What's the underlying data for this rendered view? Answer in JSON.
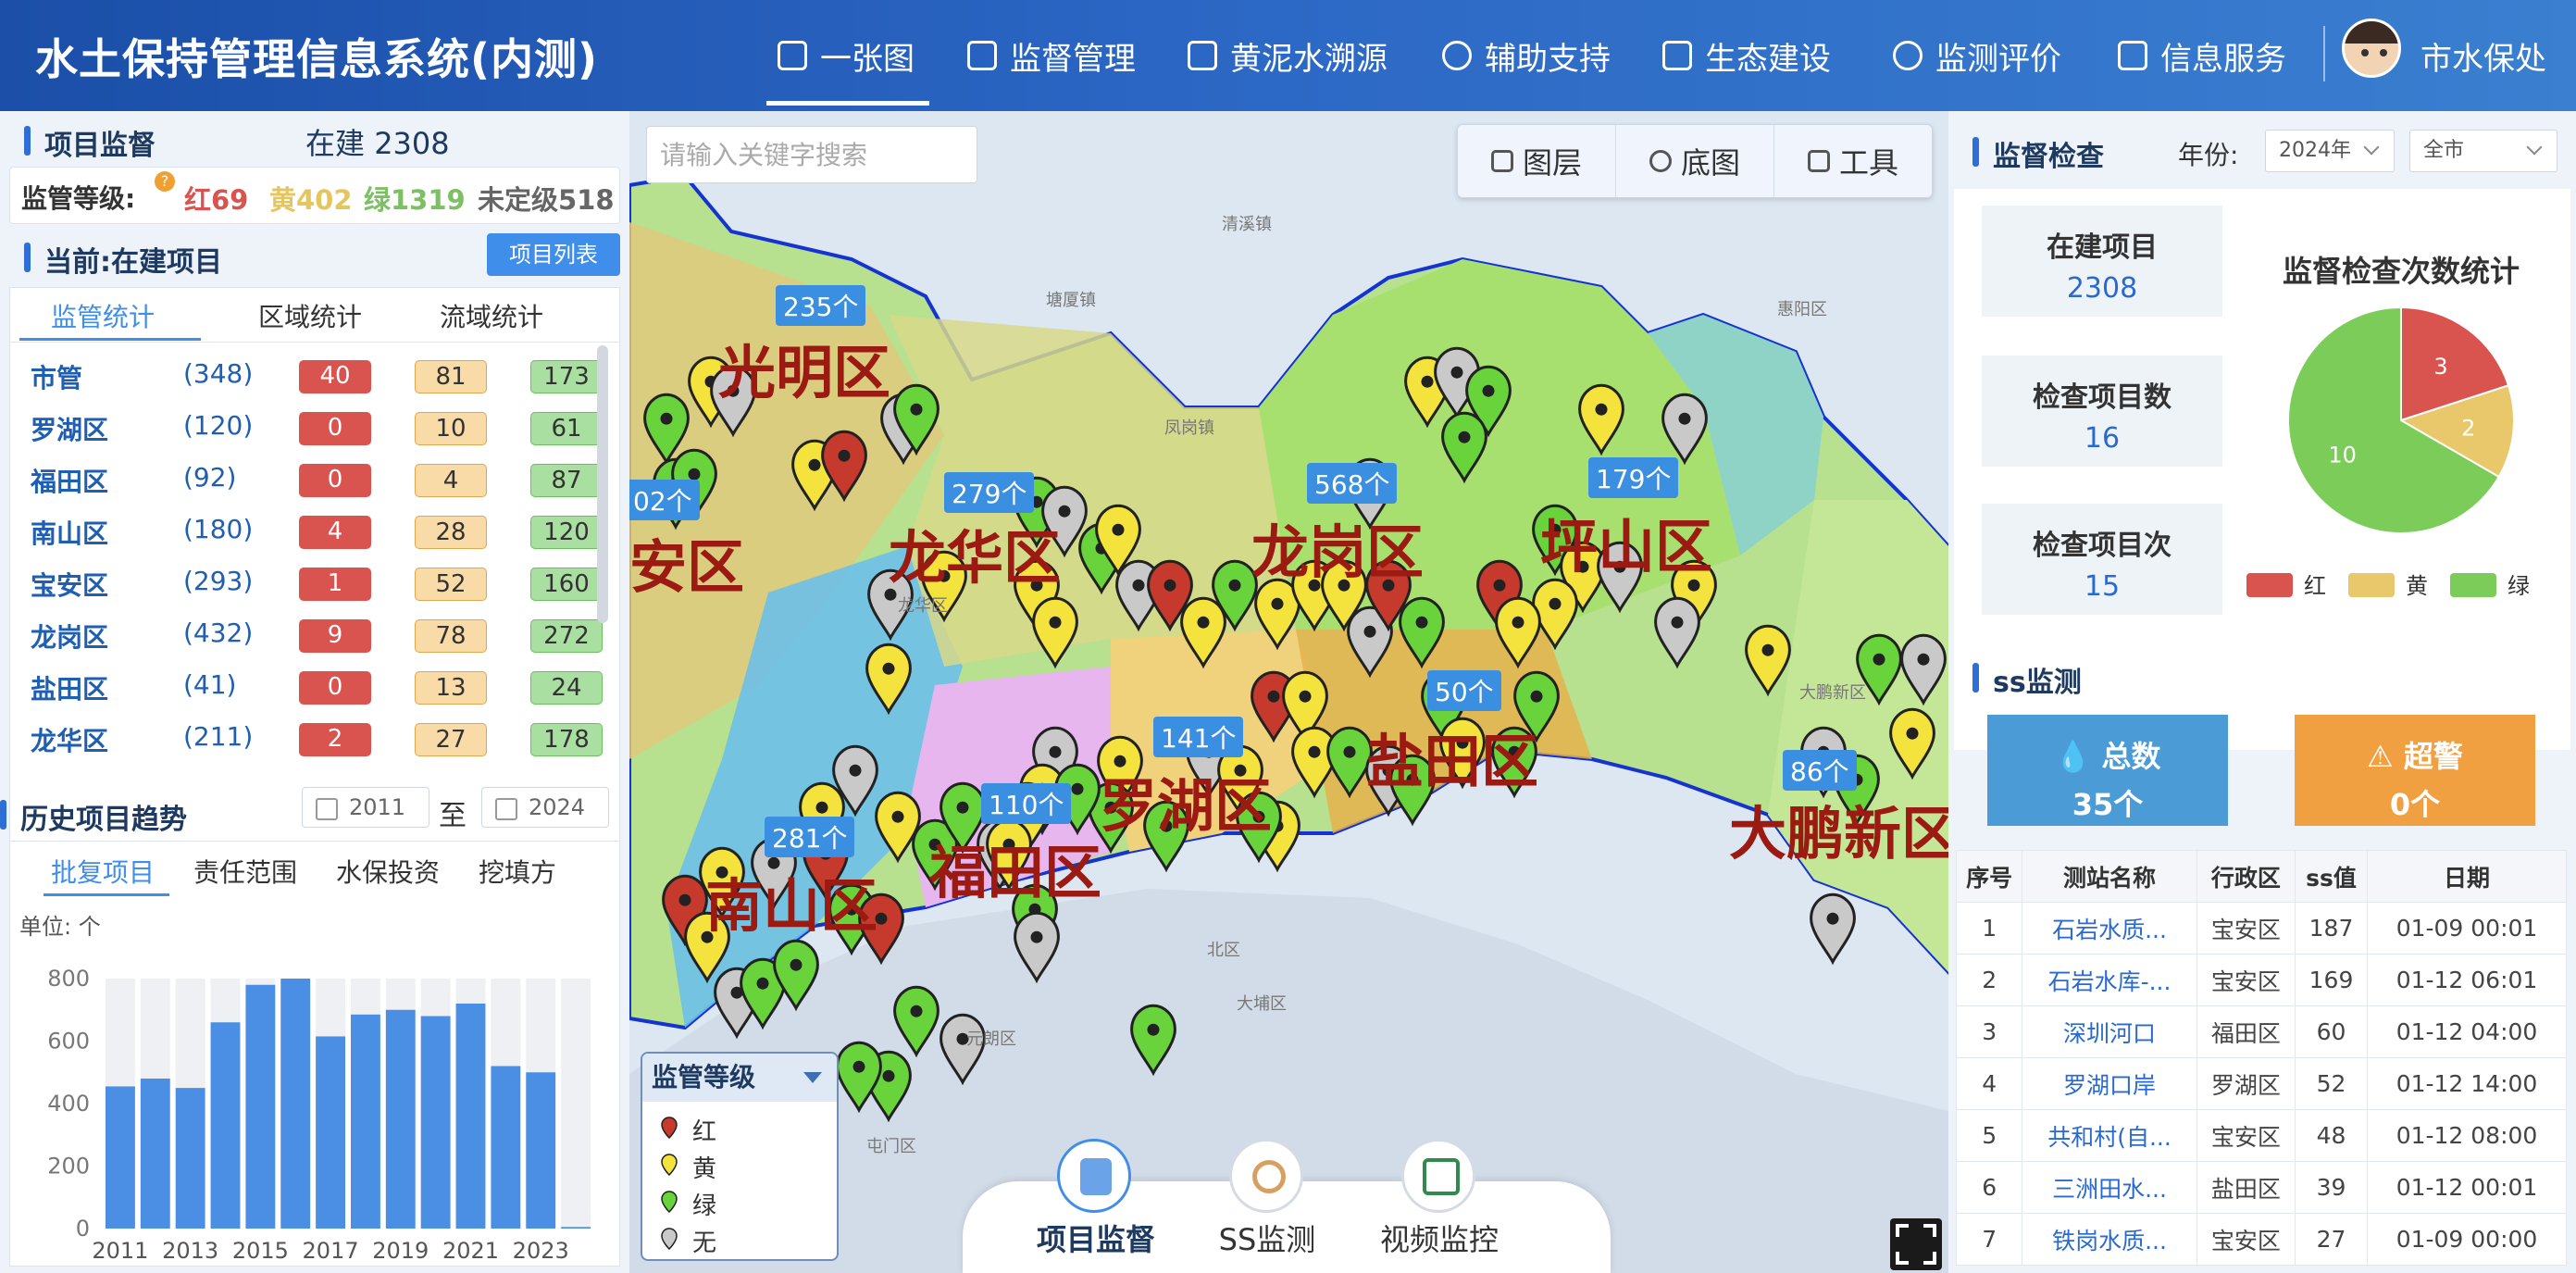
{
  "header": {
    "title": "水土保持管理信息系统(内测)",
    "nav": [
      "一张图",
      "监督管理",
      "黄泥水溯源",
      "辅助支持",
      "生态建设",
      "监测评价",
      "信息服务"
    ],
    "user": "市水保处"
  },
  "project": {
    "title": "项目监督",
    "building_label": "在建",
    "building_count": "2308",
    "level_label": "监管等级:",
    "levels": {
      "red": "红69",
      "yellow": "黄402",
      "green": "绿1319",
      "none": "未定级518"
    },
    "current_label": "当前:在建项目",
    "list_button": "项目列表",
    "tabs": [
      "监管统计",
      "区域统计",
      "流域统计"
    ],
    "rows": [
      {
        "name": "市管",
        "count": "(348)",
        "red": "40",
        "yellow": "81",
        "green": "173"
      },
      {
        "name": "罗湖区",
        "count": "(120)",
        "red": "0",
        "yellow": "10",
        "green": "61"
      },
      {
        "name": "福田区",
        "count": "(92)",
        "red": "0",
        "yellow": "4",
        "green": "87"
      },
      {
        "name": "南山区",
        "count": "(180)",
        "red": "4",
        "yellow": "28",
        "green": "120"
      },
      {
        "name": "宝安区",
        "count": "(293)",
        "red": "1",
        "yellow": "52",
        "green": "160"
      },
      {
        "name": "龙岗区",
        "count": "(432)",
        "red": "9",
        "yellow": "78",
        "green": "272"
      },
      {
        "name": "盐田区",
        "count": "(41)",
        "red": "0",
        "yellow": "13",
        "green": "24"
      },
      {
        "name": "龙华区",
        "count": "(211)",
        "red": "2",
        "yellow": "27",
        "green": "178"
      }
    ]
  },
  "trend": {
    "title": "历史项目趋势",
    "from": "2011",
    "to_label": "至",
    "to": "2024",
    "tabs": [
      "批复项目",
      "责任范围",
      "水保投资",
      "挖填方"
    ],
    "unit": "单位: 个"
  },
  "chart_data": [
    {
      "type": "bar",
      "categories": [
        "2011",
        "2012",
        "2013",
        "2014",
        "2015",
        "2016",
        "2017",
        "2018",
        "2019",
        "2020",
        "2021",
        "2022",
        "2023",
        "2024"
      ],
      "values": [
        455,
        480,
        450,
        660,
        780,
        800,
        615,
        685,
        700,
        680,
        720,
        520,
        500,
        5
      ],
      "ylim": [
        0,
        800
      ],
      "yticks": [
        0,
        200,
        400,
        600,
        800
      ],
      "xtick_labels": [
        "2011",
        "2013",
        "2015",
        "2017",
        "2019",
        "2021",
        "2023"
      ],
      "grid": false,
      "color": "#4a8fe4"
    },
    {
      "type": "pie",
      "title": "监督检查次数统计",
      "labels": [
        "红",
        "黄",
        "绿"
      ],
      "values": [
        3,
        2,
        10
      ],
      "colors": [
        "#d9534f",
        "#e8c86a",
        "#7ccc5a"
      ],
      "legend": "bottom"
    }
  ],
  "map": {
    "search_placeholder": "请输入关键字搜索",
    "tools": [
      "图层",
      "底图",
      "工具"
    ],
    "districts": [
      "光明区",
      "龙华区",
      "龙岗区",
      "坪山区",
      "宝安区",
      "罗湖区",
      "福田区",
      "盐田区",
      "南山区",
      "大鹏新区"
    ],
    "counts": [
      "235个",
      "279个",
      "568个",
      "179个",
      "02个",
      "50个",
      "141个",
      "110个",
      "281个",
      "86个"
    ],
    "legend_title": "监管等级",
    "legend_items": [
      "红",
      "黄",
      "绿",
      "无"
    ],
    "bottom": [
      "项目监督",
      "SS监测",
      "视频监控"
    ],
    "places": [
      "清溪镇",
      "塘厦镇",
      "凤岗镇",
      "惠阳区",
      "龙华区",
      "大鹏新区",
      "北区",
      "大埔区",
      "元朗区",
      "屯门区"
    ]
  },
  "inspection": {
    "title": "监督检查",
    "year_label": "年份:",
    "year": "2024年",
    "city": "全市",
    "stats": [
      {
        "label": "在建项目",
        "value": "2308"
      },
      {
        "label": "检查项目数",
        "value": "16"
      },
      {
        "label": "检查项目次",
        "value": "15"
      }
    ]
  },
  "ss": {
    "title": "ss监测",
    "total_label": "总数",
    "total_value": "35个",
    "alarm_label": "超警",
    "alarm_value": "0个",
    "columns": [
      "序号",
      "测站名称",
      "行政区",
      "ss值",
      "日期"
    ],
    "rows": [
      [
        "1",
        "石岩水质...",
        "宝安区",
        "187",
        "01-09 00:01"
      ],
      [
        "2",
        "石岩水库-...",
        "宝安区",
        "169",
        "01-12 06:01"
      ],
      [
        "3",
        "深圳河口",
        "福田区",
        "60",
        "01-12 04:00"
      ],
      [
        "4",
        "罗湖口岸",
        "罗湖区",
        "52",
        "01-12 14:00"
      ],
      [
        "5",
        "共和村(自...",
        "宝安区",
        "48",
        "01-12 08:00"
      ],
      [
        "6",
        "三洲田水...",
        "盐田区",
        "39",
        "01-12 00:01"
      ],
      [
        "7",
        "铁岗水质...",
        "宝安区",
        "27",
        "01-09 00:00"
      ]
    ]
  },
  "colors": {
    "header": "#2b66c4",
    "accent": "#3f8ee9",
    "red": "#d9534f",
    "yellow": "#e8c86a",
    "green": "#7ccc5a",
    "ss_total": "#4a9bd6",
    "ss_alarm": "#f0a040"
  }
}
